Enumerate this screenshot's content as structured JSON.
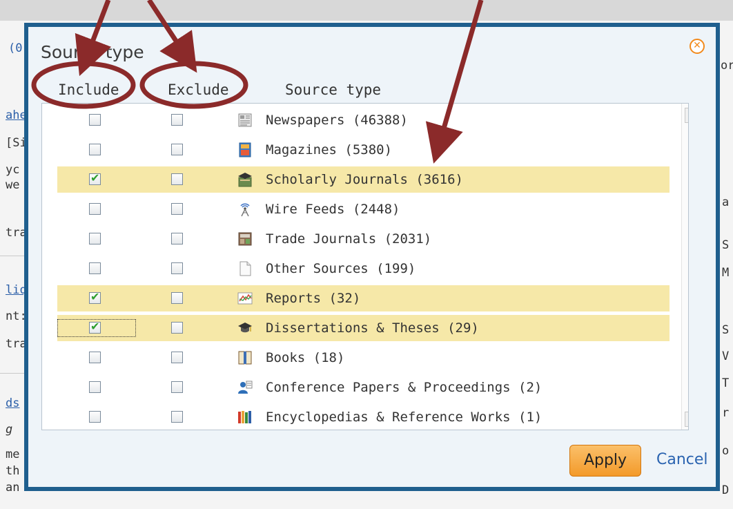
{
  "background": {
    "snippets": [
      "(0",
      "ahe",
      "[Si",
      "yc",
      "we",
      "tra",
      "liq",
      "nt:",
      "tra",
      "ds",
      "g",
      "me",
      "th",
      "an",
      "or",
      "a",
      "S",
      "M",
      "S",
      "V",
      "T",
      "r",
      "o",
      "D"
    ]
  },
  "dialog": {
    "title": "Source type",
    "close_icon": "close-circle-icon",
    "columns": {
      "include": "Include",
      "exclude": "Exclude",
      "source_type": "Source type"
    },
    "rows": [
      {
        "label": "Newspapers (46388)",
        "icon": "newspaper-icon",
        "include": false,
        "exclude": false,
        "highlighted": false
      },
      {
        "label": "Magazines (5380)",
        "icon": "magazine-icon",
        "include": false,
        "exclude": false,
        "highlighted": false
      },
      {
        "label": "Scholarly Journals (3616)",
        "icon": "scholarly-journal-icon",
        "include": true,
        "exclude": false,
        "highlighted": true
      },
      {
        "label": "Wire Feeds (2448)",
        "icon": "wire-feed-icon",
        "include": false,
        "exclude": false,
        "highlighted": false
      },
      {
        "label": "Trade Journals (2031)",
        "icon": "trade-journal-icon",
        "include": false,
        "exclude": false,
        "highlighted": false
      },
      {
        "label": "Other Sources (199)",
        "icon": "document-icon",
        "include": false,
        "exclude": false,
        "highlighted": false
      },
      {
        "label": "Reports (32)",
        "icon": "report-chart-icon",
        "include": true,
        "exclude": false,
        "highlighted": true
      },
      {
        "label": "Dissertations & Theses (29)",
        "icon": "graduation-cap-icon",
        "include": true,
        "exclude": false,
        "highlighted": true,
        "focused": true
      },
      {
        "label": "Books (18)",
        "icon": "book-icon",
        "include": false,
        "exclude": false,
        "highlighted": false
      },
      {
        "label": "Conference Papers & Proceedings (2)",
        "icon": "conference-icon",
        "include": false,
        "exclude": false,
        "highlighted": false
      },
      {
        "label": "Encyclopedias & Reference Works (1)",
        "icon": "encyclopedia-icon",
        "include": false,
        "exclude": false,
        "highlighted": false
      }
    ],
    "apply_label": "Apply",
    "cancel_label": "Cancel"
  },
  "colors": {
    "dialog_border": "#1f5f8e",
    "highlight": "#f6e8a8",
    "apply_button": "#f39a2a",
    "annotation": "#8b2a2a",
    "check": "#2e9e2e",
    "cancel_link": "#2a63b0"
  }
}
